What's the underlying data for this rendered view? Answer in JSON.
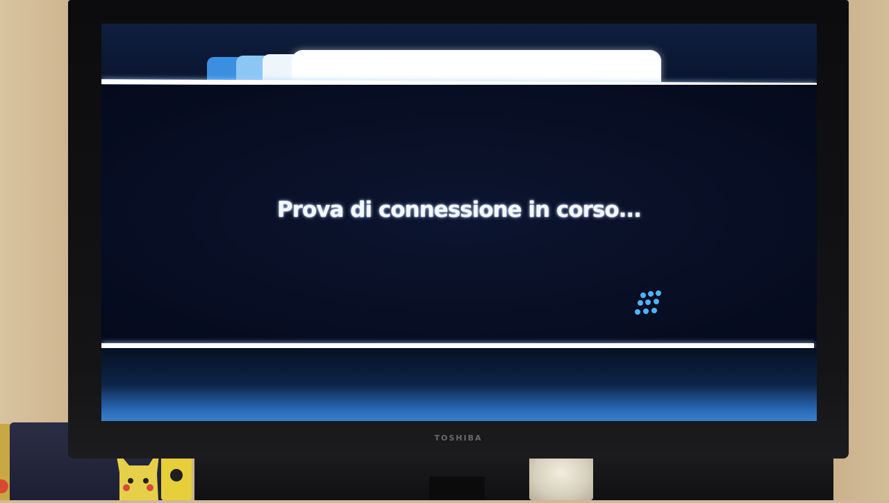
{
  "tv": {
    "brand": "TOSHIBA"
  },
  "screen": {
    "status_message": "Prova di connessione in corso...",
    "spinner_icon": "loading-dots-icon",
    "colors": {
      "background": "#050b1e",
      "accent": "#3a8fe0",
      "text": "#f4f8ff"
    }
  }
}
